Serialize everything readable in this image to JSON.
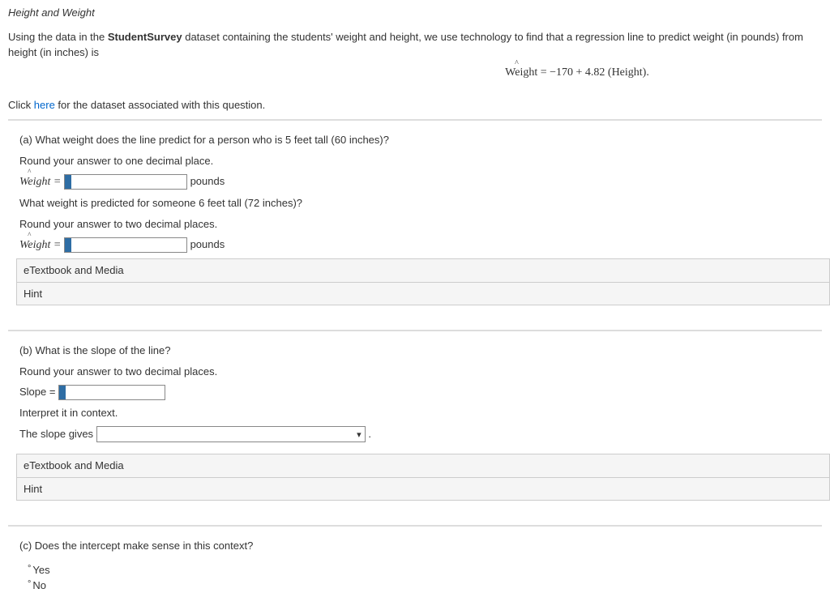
{
  "title": "Height and Weight",
  "intro_pre": "Using the data in the ",
  "intro_bold": "StudentSurvey",
  "intro_post": " dataset containing the students' weight and height, we use technology to find that a regression line to predict weight (in pounds) from height (in inches) is",
  "equation": "Weight = −170 + 4.82 (Height).",
  "dataset_hint_pre": "Click ",
  "dataset_link": "here",
  "dataset_hint_post": " for the dataset associated with this question.",
  "part_a": {
    "q1": "(a) What weight does the line predict for a person who is 5 feet tall (60 inches)?",
    "round1": "Round your answer to one decimal place.",
    "label": "Weight =",
    "unit": "pounds",
    "q2": "What weight is predicted for someone 6 feet tall (72 inches)?",
    "round2": "Round your answer to two decimal places."
  },
  "etext": "eTextbook and Media",
  "hint": "Hint",
  "part_b": {
    "q": "(b) What is the slope of the line?",
    "round": "Round your answer to two decimal places.",
    "slope_label": "Slope =",
    "interpret": "Interpret it in context.",
    "slope_gives": "The slope gives",
    "period": "."
  },
  "part_c": {
    "q": "(c) Does the intercept make sense in this context?",
    "yes": "Yes",
    "no": "No"
  }
}
